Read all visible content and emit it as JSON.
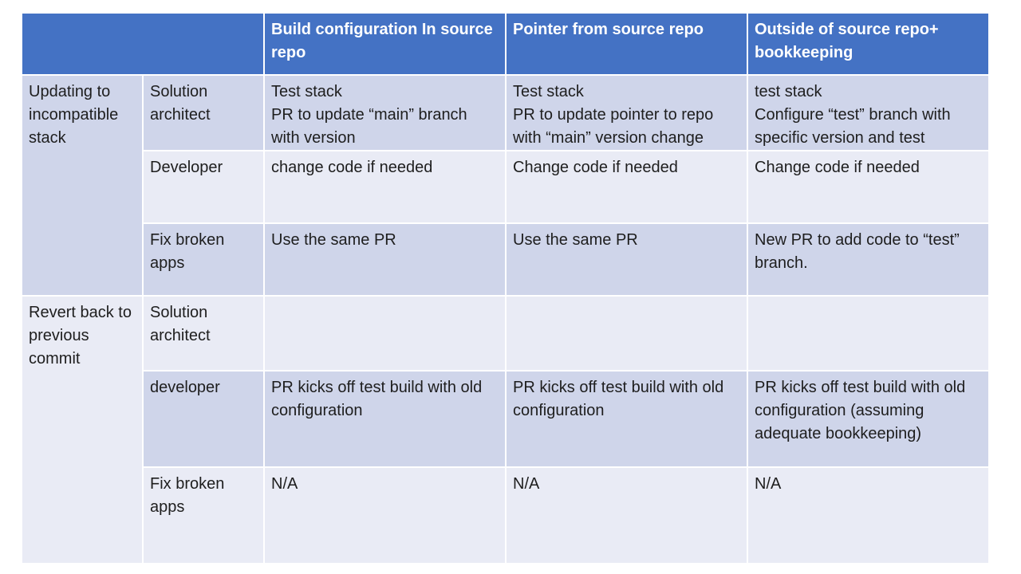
{
  "header": {
    "corner": "",
    "col1": "Build configuration In source repo",
    "col2": "Pointer from source repo",
    "col3": "Outside of source repo+ bookkeeping"
  },
  "groups": [
    {
      "label": "Updating to incompatible stack",
      "rows": [
        {
          "role": "Solution architect",
          "c1": "Test stack\nPR to update “main” branch with version",
          "c2": "Test stack\nPR to update pointer to repo with “main” version change",
          "c3": "test stack\nConfigure “test” branch with specific version and test"
        },
        {
          "role": "Developer",
          "c1": "change code if needed",
          "c2": "Change code if needed",
          "c3": "Change code if needed"
        },
        {
          "role": "Fix broken apps",
          "c1": "Use the same PR",
          "c2": "Use the same PR",
          "c3": "New PR to add code to “test” branch."
        }
      ]
    },
    {
      "label": "Revert back to previous commit",
      "rows": [
        {
          "role": "Solution architect",
          "c1": "",
          "c2": "",
          "c3": ""
        },
        {
          "role": "developer",
          "c1": "PR kicks off test build with old configuration",
          "c2": "PR kicks off test build with old configuration",
          "c3": "PR kicks off test build with old configuration (assuming adequate bookkeeping)"
        },
        {
          "role": "Fix broken apps",
          "c1": "N/A",
          "c2": "N/A",
          "c3": "N/A"
        }
      ]
    }
  ],
  "colors": {
    "header": "#4472c4",
    "band_dark": "#cfd5ea",
    "band_light": "#e9ebf5"
  }
}
